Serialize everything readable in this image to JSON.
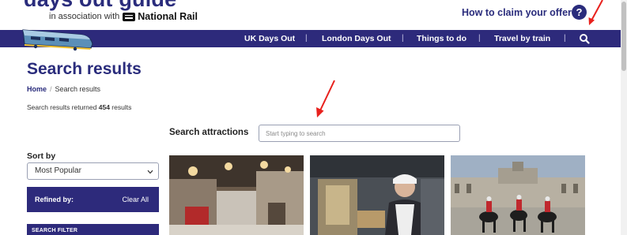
{
  "header": {
    "logo_text": "days out guide",
    "assoc_text": "in association with",
    "partner_name": "National Rail",
    "claim_link": "How to claim your offer",
    "help_symbol": "?"
  },
  "nav": {
    "items": [
      "UK Days Out",
      "London Days Out",
      "Things to do",
      "Travel by train"
    ],
    "separator": "|",
    "search_icon": "search-icon"
  },
  "page": {
    "title": "Search results",
    "breadcrumb": {
      "home": "Home",
      "separator": "/",
      "current": "Search results"
    },
    "results_prefix": "Search results returned",
    "results_count": "454",
    "results_suffix": "results"
  },
  "search": {
    "label": "Search attractions",
    "placeholder": "Start typing to search",
    "value": ""
  },
  "sidebar": {
    "sort_label": "Sort by",
    "sort_value": "Most Popular",
    "refined_label": "Refined by:",
    "clear_all": "Clear All",
    "filter_heading": "SEARCH FILTER"
  },
  "cards": [
    {
      "image": "restaurant-interior-photo"
    },
    {
      "image": "victorian-nurse-exhibit-photo"
    },
    {
      "image": "horse-guards-parade-photo"
    }
  ],
  "colors": {
    "brand_navy": "#2d2a7b",
    "annotation_red": "#e8211d"
  }
}
